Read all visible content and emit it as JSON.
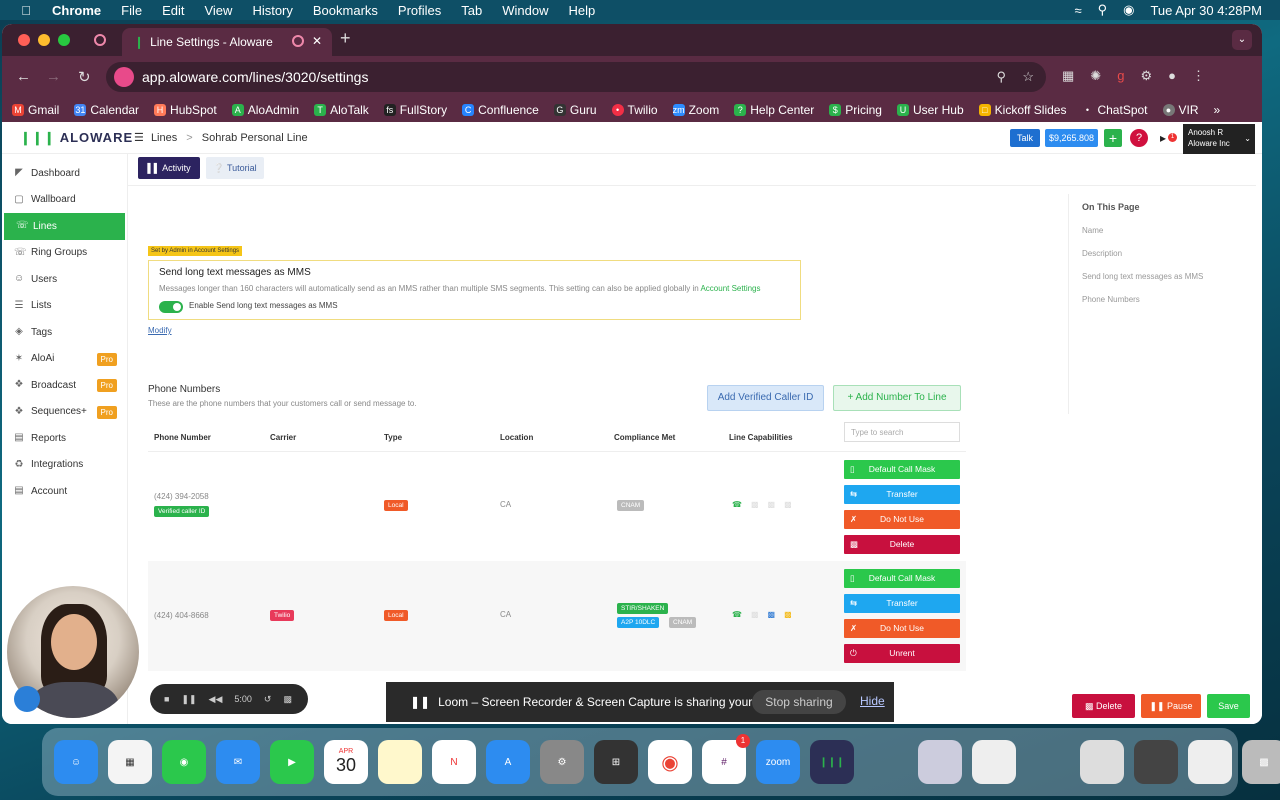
{
  "menubar": {
    "apple_icon": "apple-icon",
    "items": [
      "Chrome",
      "File",
      "Edit",
      "View",
      "History",
      "Bookmarks",
      "Profiles",
      "Tab",
      "Window",
      "Help"
    ],
    "datetime": "Tue Apr 30  4:28PM"
  },
  "browser": {
    "tab_title": "Line Settings - Aloware",
    "url": "app.aloware.com/lines/3020/settings",
    "bookmarks": [
      "Gmail",
      "Calendar",
      "HubSpot",
      "AloAdmin",
      "AloTalk",
      "FullStory",
      "Confluence",
      "Guru",
      "Twilio",
      "Zoom",
      "Help Center",
      "Pricing",
      "User Hub",
      "Kickoff Slides",
      "ChatSpot",
      "VIR"
    ],
    "ext_badge": "1"
  },
  "header": {
    "logo": "ALOWARE",
    "breadcrumb_root": "Lines",
    "breadcrumb_sep": ">",
    "breadcrumb_page": "Sohrab Personal Line",
    "talk": "Talk",
    "balance": "$9,265.808",
    "notif_count": "1",
    "user_name": "Anoosh R",
    "user_company": "Aloware Inc"
  },
  "sidebar": {
    "items": [
      {
        "label": "Dashboard",
        "icon": "dashboard-icon"
      },
      {
        "label": "Wallboard",
        "icon": "wallboard-icon"
      },
      {
        "label": "Lines",
        "icon": "lines-icon"
      },
      {
        "label": "Ring Groups",
        "icon": "ring-groups-icon"
      },
      {
        "label": "Users",
        "icon": "users-icon"
      },
      {
        "label": "Lists",
        "icon": "lists-icon"
      },
      {
        "label": "Tags",
        "icon": "tags-icon"
      },
      {
        "label": "AloAi",
        "icon": "aloai-icon",
        "badge": "Pro"
      },
      {
        "label": "Broadcast",
        "icon": "broadcast-icon",
        "badge": "Pro"
      },
      {
        "label": "Sequences+",
        "icon": "sequences-icon",
        "badge": "Pro"
      },
      {
        "label": "Reports",
        "icon": "reports-icon"
      },
      {
        "label": "Integrations",
        "icon": "integrations-icon"
      },
      {
        "label": "Account",
        "icon": "account-icon"
      }
    ],
    "active_index": 2
  },
  "toolbar": {
    "activity": "Activity",
    "tutorial": "Tutorial"
  },
  "mms": {
    "admin_badge": "Set by Admin in Account Settings",
    "title": "Send long text messages as MMS",
    "desc": "Messages longer than 160 characters will automatically send as an MMS rather than multiple SMS segments. This setting can also be applied globally in",
    "link": "Account Settings",
    "toggle_label": "Enable Send long text messages as MMS",
    "toggle_on": true,
    "modify": "Modify"
  },
  "phone_numbers": {
    "title": "Phone Numbers",
    "subtitle": "These are the phone numbers that your customers call or send message to.",
    "add_verified": "Add Verified Caller ID",
    "add_number": "Add Number To Line",
    "columns": [
      "Phone Number",
      "Carrier",
      "Type",
      "Location",
      "Compliance Met",
      "Line Capabilities"
    ],
    "search_placeholder": "Type to search",
    "rows": [
      {
        "number": "(424) 394-2058",
        "number_tag": "Verified caller ID",
        "carrier": "",
        "type": "Local",
        "location": "CA",
        "compliance": [
          "CNAM"
        ],
        "actions": [
          "Default Call Mask",
          "Transfer",
          "Do Not Use",
          "Delete"
        ]
      },
      {
        "number": "(424) 404-8668",
        "number_tag": "",
        "carrier": "Twilio",
        "type": "Local",
        "location": "CA",
        "compliance": [
          "STIR/SHAKEN",
          "A2P 10DLC",
          "CNAM"
        ],
        "actions": [
          "Default Call Mask",
          "Transfer",
          "Do Not Use",
          "Unrent"
        ]
      }
    ]
  },
  "on_this_page": {
    "title": "On This Page",
    "items": [
      "Name",
      "Description",
      "Send long text messages as MMS",
      "Phone Numbers"
    ]
  },
  "footer": {
    "delete": "Delete",
    "pause": "Pause",
    "save": "Save"
  },
  "recorder": {
    "time": "5:00"
  },
  "loom": {
    "message": "Loom – Screen Recorder & Screen Capture is sharing your screen.",
    "stop": "Stop sharing",
    "hide": "Hide"
  },
  "dock": {
    "calendar_month": "APR",
    "calendar_day": "30",
    "slack_badge": "1",
    "zoom_label": "zoom"
  },
  "colors": {
    "brand_green": "#2bb24c",
    "navy": "#2c2360",
    "blue": "#1ea7f0",
    "orange": "#f05a28",
    "crimson": "#c8103e"
  }
}
